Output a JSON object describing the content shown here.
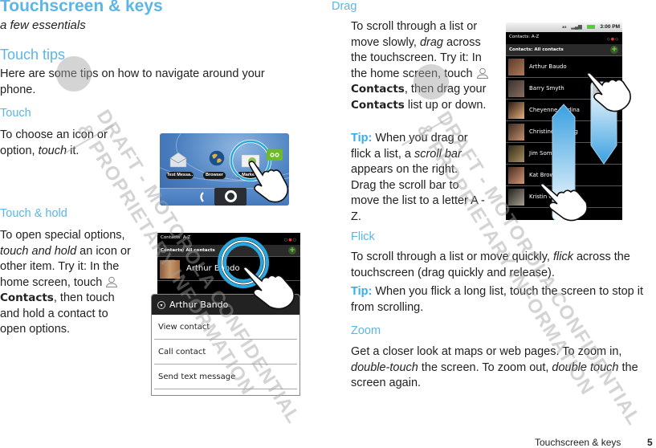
{
  "header": {
    "title": "Touchscreen & keys",
    "subtitle": "a few essentials"
  },
  "sections": {
    "touch_tips": {
      "heading": "Touch tips",
      "body": "Here are some tips on how to navigate around your phone."
    },
    "touch": {
      "heading": "Touch",
      "body_before": "To choose an icon or option, ",
      "body_em": "touch",
      "body_after": " it."
    },
    "touch_hold": {
      "heading": "Touch & hold",
      "body_before": "To open special options, ",
      "body_em": "touch and hold",
      "body_mid": " an icon or other item. Try it: In the home screen, touch ",
      "body_strong": "Contacts",
      "body_after": ", then touch and hold a contact to open options."
    },
    "drag": {
      "heading": "Drag",
      "body_before": "To scroll through a list or move slowly, ",
      "body_em": "drag",
      "body_mid": " across the touchscreen. Try it: In the home screen, touch ",
      "body_strong1": "Contacts",
      "body_mid2": ", then drag your ",
      "body_strong2": "Contacts",
      "body_after": " list up or down.",
      "tip_label": "Tip:",
      "tip_before": " When you drag or flick a list, a ",
      "tip_em": "scroll bar",
      "tip_after": " appears on the right. Drag the scroll bar to move the list to a letter A - Z."
    },
    "flick": {
      "heading": "Flick",
      "body_before": "To scroll through a list or move quickly, ",
      "body_em": "flick",
      "body_after": " across the touchscreen (drag quickly and release).",
      "tip_label": "Tip:",
      "tip_text": " When you flick a long list, touch the screen to stop it from scrolling."
    },
    "zoom": {
      "heading": "Zoom",
      "body_before": "Get a closer look at maps or web pages. To zoom in, ",
      "body_em1": "double-touch",
      "body_mid": " the screen. To zoom out, ",
      "body_em2": "double touch",
      "body_after": " the screen again."
    }
  },
  "figures": {
    "touch_home": {
      "apps": [
        "Text Messa..",
        "Browser",
        "Market"
      ],
      "icons": [
        "envelope-icon",
        "globe-icon",
        "market-icon",
        "voicemail-icon",
        "phone-icon",
        "home-ring-icon"
      ]
    },
    "touch_hold_contacts": {
      "tab_title": "Contacts: A-Z",
      "list_title": "Contacts: All contacts",
      "contact_name": "Arthur Bando",
      "menu_title": "Arthur Bando",
      "menu_items": [
        "View contact",
        "Call contact",
        "Send text message"
      ]
    },
    "drag_contacts": {
      "status_network": "3G",
      "status_time": "3:00 PM",
      "tab_title": "Contacts: A-Z",
      "list_title": "Contacts: All contacts",
      "contacts": [
        "Arthur Baudo",
        "Barry Smyth",
        "Cheyenne Medina",
        "Christine Fanning",
        "Jim Somers",
        "Kat Brown",
        "Kristin Cullen"
      ]
    }
  },
  "watermarks": [
    "DRAFT - MOTOROLA CONFIDENTIAL",
    "& PROPRIETARY INFORMATION"
  ],
  "footer": {
    "section": "Touchscreen & keys",
    "page": "5"
  },
  "colors": {
    "accent": "#5bb5e5",
    "tip": "#36aee8",
    "text": "#222222"
  }
}
